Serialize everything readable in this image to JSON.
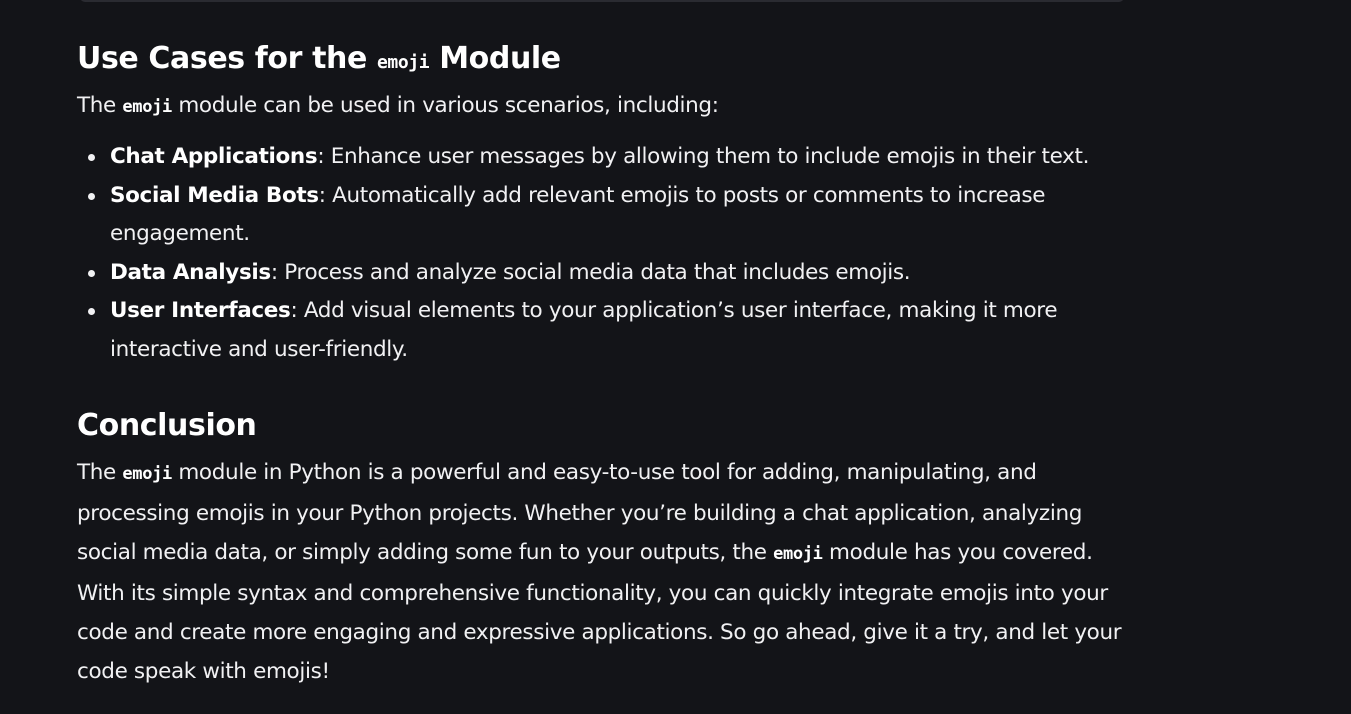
{
  "section_use_cases": {
    "heading_before": "Use Cases for the ",
    "heading_code": "emoji",
    "heading_after": " Module",
    "intro_before": "The ",
    "intro_code": "emoji",
    "intro_after": " module can be used in various scenarios, including:",
    "items": [
      {
        "term": "Chat Applications",
        "desc": ": Enhance user messages by allowing them to include emojis in their text."
      },
      {
        "term": "Social Media Bots",
        "desc": ": Automatically add relevant emojis to posts or comments to increase engagement."
      },
      {
        "term": "Data Analysis",
        "desc": ": Process and analyze social media data that includes emojis."
      },
      {
        "term": "User Interfaces",
        "desc": ": Add visual elements to your application’s user interface, making it more interactive and user-friendly."
      }
    ]
  },
  "section_conclusion": {
    "heading": "Conclusion",
    "p_part1": "The ",
    "p_code1": "emoji",
    "p_part2": " module in Python is a powerful and easy-to-use tool for adding, manipulating, and processing emojis in your Python projects. Whether you’re building a chat application, analyzing social media data, or simply adding some fun to your outputs, the ",
    "p_code2": "emoji",
    "p_part3": " module has you covered. With its simple syntax and comprehensive functionality, you can quickly integrate emojis into your code and create more engaging and expressive applications. So go ahead, give it a try, and let your code speak with emojis!"
  }
}
